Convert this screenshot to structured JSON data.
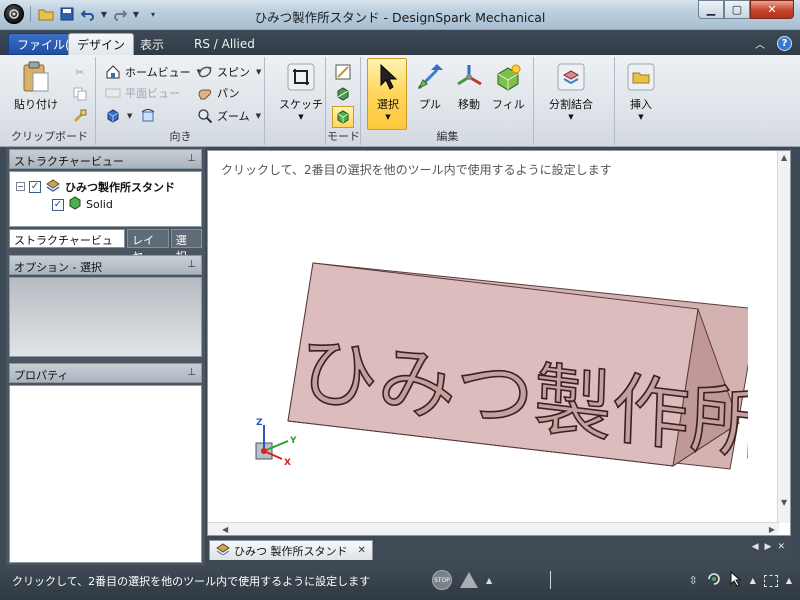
{
  "window": {
    "title": "ひみつ製作所スタンド - DesignSpark Mechanical"
  },
  "tabs": [
    {
      "label": "ファイル(F)"
    },
    {
      "label": "デザイン"
    },
    {
      "label": "表示"
    },
    {
      "label": "RS / Allied"
    }
  ],
  "ribbon": {
    "clipboard": {
      "paste": "貼り付け",
      "group": "クリップボード"
    },
    "orient": {
      "home_view": "ホームビュー",
      "plane_view": "平面ビュー",
      "spin": "スピン",
      "pan": "パン",
      "zoom": "ズーム",
      "group": "向き"
    },
    "sketch": {
      "label": "スケッチ"
    },
    "mode": {
      "group": "モード"
    },
    "edit": {
      "select": "選択",
      "pull": "プル",
      "move": "移動",
      "fill": "フィル",
      "group": "編集"
    },
    "combine": {
      "label": "分割結合"
    },
    "insert": {
      "label": "挿入"
    }
  },
  "structure": {
    "title": "ストラクチャービュー",
    "root": "ひみつ製作所スタンド",
    "child": "Solid",
    "subtabs": [
      "ストラクチャービュー",
      "レイヤ",
      "選択"
    ]
  },
  "options": {
    "title": "オプション - 選択"
  },
  "properties": {
    "title": "プロパティ"
  },
  "viewport": {
    "hint": "クリックして、2番目の選択を他のツール内で使用するように設定します",
    "triad": {
      "x": "X",
      "y": "Y",
      "z": "Z"
    },
    "model_text": "ひみつ製作所"
  },
  "doc_tab": {
    "label": "ひみつ 製作所スタンド"
  },
  "status": {
    "text": "クリックして、2番目の選択を他のツール内で使用するように設定します",
    "stop_label": "STOP"
  },
  "colors": {
    "model_top": "#c9a2a2",
    "model_front": "#d6b0b0",
    "model_side": "#b98f8f",
    "select_highlight": "#ffd65a"
  }
}
